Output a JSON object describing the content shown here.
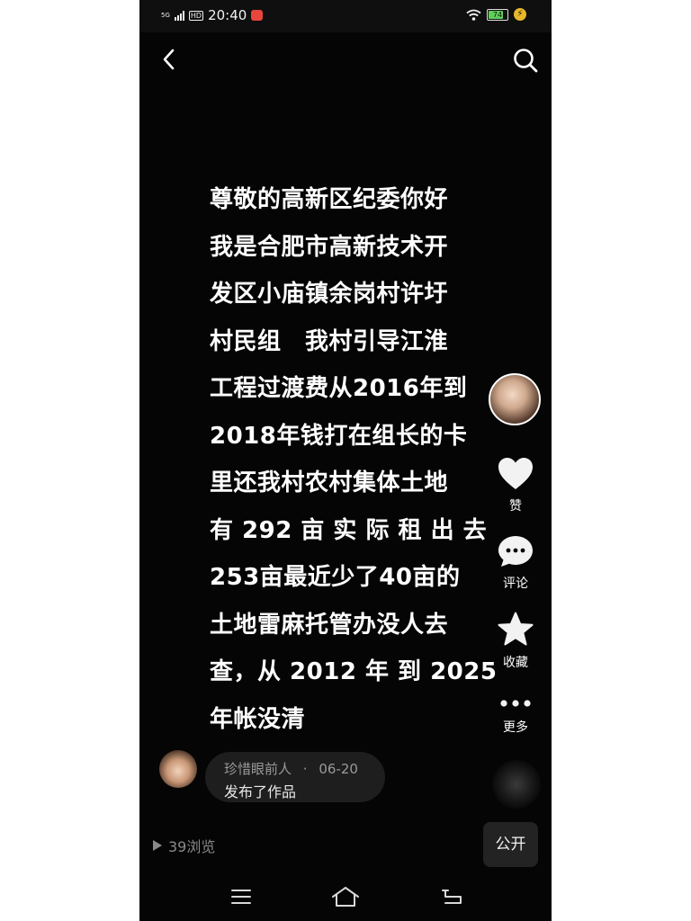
{
  "status_bar": {
    "network": "5G",
    "hd": "HD",
    "time": "20:40",
    "battery": "74"
  },
  "post": {
    "lines": [
      "尊敬的高新区纪委你好",
      "我是合肥市高新技术开",
      "发区小庙镇余岗村许圩",
      "村民组　我村引导江淮",
      "工程过渡费从2016年到",
      "2018年钱打在组长的卡",
      "里还我村农村集体土地",
      "有 292 亩 实 际 租 出 去",
      "253亩最近少了40亩的",
      "土地雷麻托管办没人去",
      "查，从 2012 年 到 2025",
      "年帐没清"
    ]
  },
  "actions": {
    "like_label": "赞",
    "comment_label": "评论",
    "favorite_label": "收藏",
    "more_label": "更多"
  },
  "author": {
    "name": "珍惜眼前人",
    "separator": "·",
    "date": "06-20",
    "activity": "发布了作品"
  },
  "footer": {
    "views": "39浏览",
    "public_label": "公开"
  },
  "colors": {
    "background": "#050505",
    "text": "#ffffff",
    "muted": "#8a8a8a"
  }
}
